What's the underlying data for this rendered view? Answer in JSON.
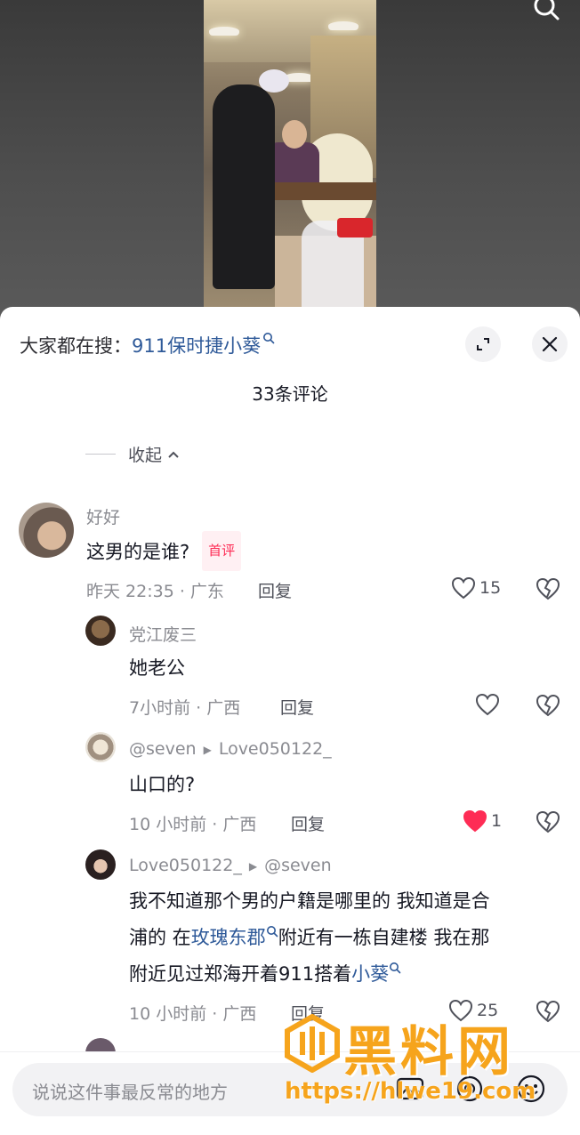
{
  "sheet": {
    "search_label": "大家都在搜：",
    "search_keyword": "911保时捷小葵",
    "comment_count": "33条评论",
    "collapse_label": "收起"
  },
  "comments": [
    {
      "user": "好好",
      "text": "这男的是谁?",
      "badge": "首评",
      "meta": "昨天 22:35 · 广东",
      "reply": "回复",
      "likes": "15"
    },
    {
      "user": "党江废三",
      "text": "她老公",
      "meta": "7小时前 · 广西",
      "reply": "回复",
      "likes": ""
    },
    {
      "user": "@seven",
      "reply_to": "Love050122_",
      "text": "山口的?",
      "meta": "10 小时前 · 广西",
      "reply": "回复",
      "likes": "1"
    },
    {
      "user": "Love050122_",
      "reply_to": "@seven",
      "text_parts": [
        "我不知道那个男的户籍是哪里的 我知道是合",
        "浦的 在",
        "玫瑰东郡",
        "附近有一栋自建楼 我在那",
        "附近见过郑海开着911搭着",
        "小葵"
      ],
      "meta": "10 小时前 · 广西",
      "reply": "回复",
      "likes": "25"
    }
  ],
  "input": {
    "placeholder": "说说这件事最反常的地方"
  },
  "watermark": {
    "name": "黑料网",
    "url": "https://hlwe19.com"
  },
  "colors": {
    "link": "#2f5a99",
    "liked": "#fe2c55",
    "watermark": "#f6a41c"
  }
}
